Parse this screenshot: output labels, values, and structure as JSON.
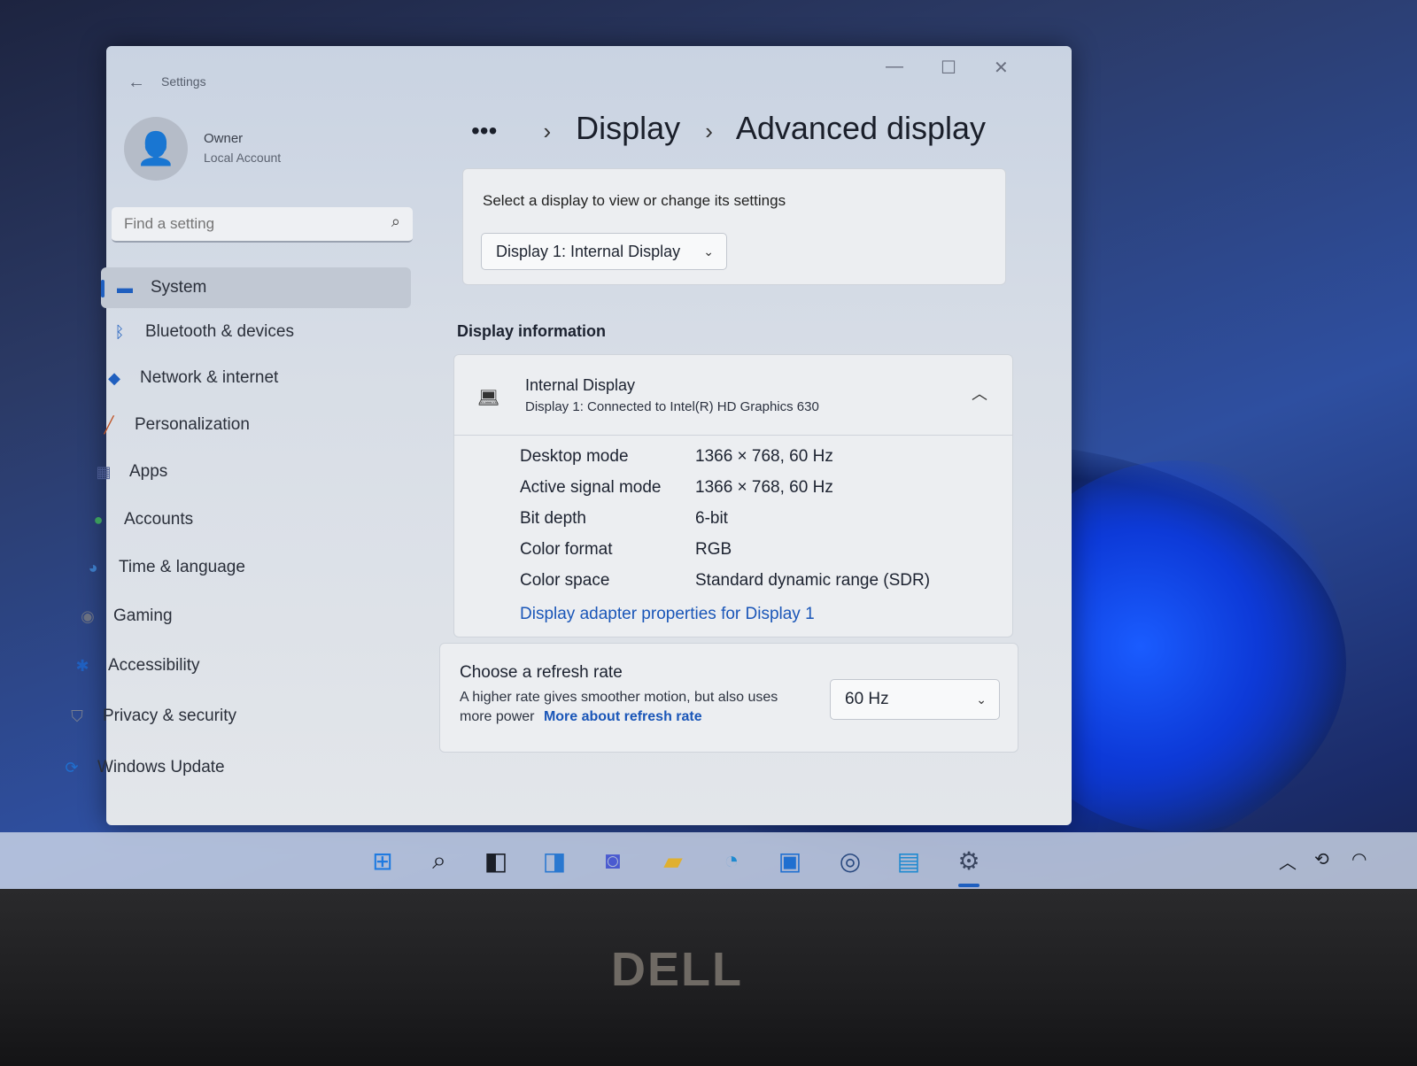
{
  "window": {
    "title": "Settings",
    "profile": {
      "name": "Owner",
      "account": "Local Account"
    },
    "search": {
      "placeholder": "Find a setting"
    },
    "nav": [
      {
        "label": "System",
        "icon": "monitor-icon",
        "active": true
      },
      {
        "label": "Bluetooth & devices",
        "icon": "bluetooth-icon"
      },
      {
        "label": "Network & internet",
        "icon": "wifi-icon"
      },
      {
        "label": "Personalization",
        "icon": "brush-icon"
      },
      {
        "label": "Apps",
        "icon": "apps-icon"
      },
      {
        "label": "Accounts",
        "icon": "person-icon"
      },
      {
        "label": "Time & language",
        "icon": "globe-clock-icon"
      },
      {
        "label": "Gaming",
        "icon": "controller-icon"
      },
      {
        "label": "Accessibility",
        "icon": "accessibility-icon"
      },
      {
        "label": "Privacy & security",
        "icon": "shield-icon"
      },
      {
        "label": "Windows Update",
        "icon": "update-icon"
      }
    ]
  },
  "breadcrumb": {
    "ellipsis": "•••",
    "items": [
      "Display",
      "Advanced display"
    ]
  },
  "display_select": {
    "prompt": "Select a display to view or change its settings",
    "selected": "Display 1: Internal Display"
  },
  "display_info": {
    "heading": "Display information",
    "name": "Internal Display",
    "subtitle": "Display 1: Connected to Intel(R) HD Graphics 630",
    "rows": [
      {
        "key": "Desktop mode",
        "value": "1366 × 768, 60 Hz"
      },
      {
        "key": "Active signal mode",
        "value": "1366 × 768, 60 Hz"
      },
      {
        "key": "Bit depth",
        "value": "6-bit"
      },
      {
        "key": "Color format",
        "value": "RGB"
      },
      {
        "key": "Color space",
        "value": "Standard dynamic range (SDR)"
      }
    ],
    "adapter_link": "Display adapter properties for Display 1"
  },
  "refresh_rate": {
    "title": "Choose a refresh rate",
    "description": "A higher rate gives smoother motion, but also uses more power",
    "link": "More about refresh rate",
    "selected": "60 Hz"
  },
  "taskbar": {
    "icons": [
      "windows-start-icon",
      "search-icon",
      "task-view-icon",
      "widgets-icon",
      "teams-chat-icon",
      "file-explorer-icon",
      "edge-icon",
      "store-icon",
      "camera-icon",
      "display-app-icon",
      "settings-gear-icon"
    ]
  },
  "bezel": {
    "brand": "DELL"
  },
  "colors": {
    "accent": "#1f5fbf",
    "link": "#1a56b8"
  }
}
